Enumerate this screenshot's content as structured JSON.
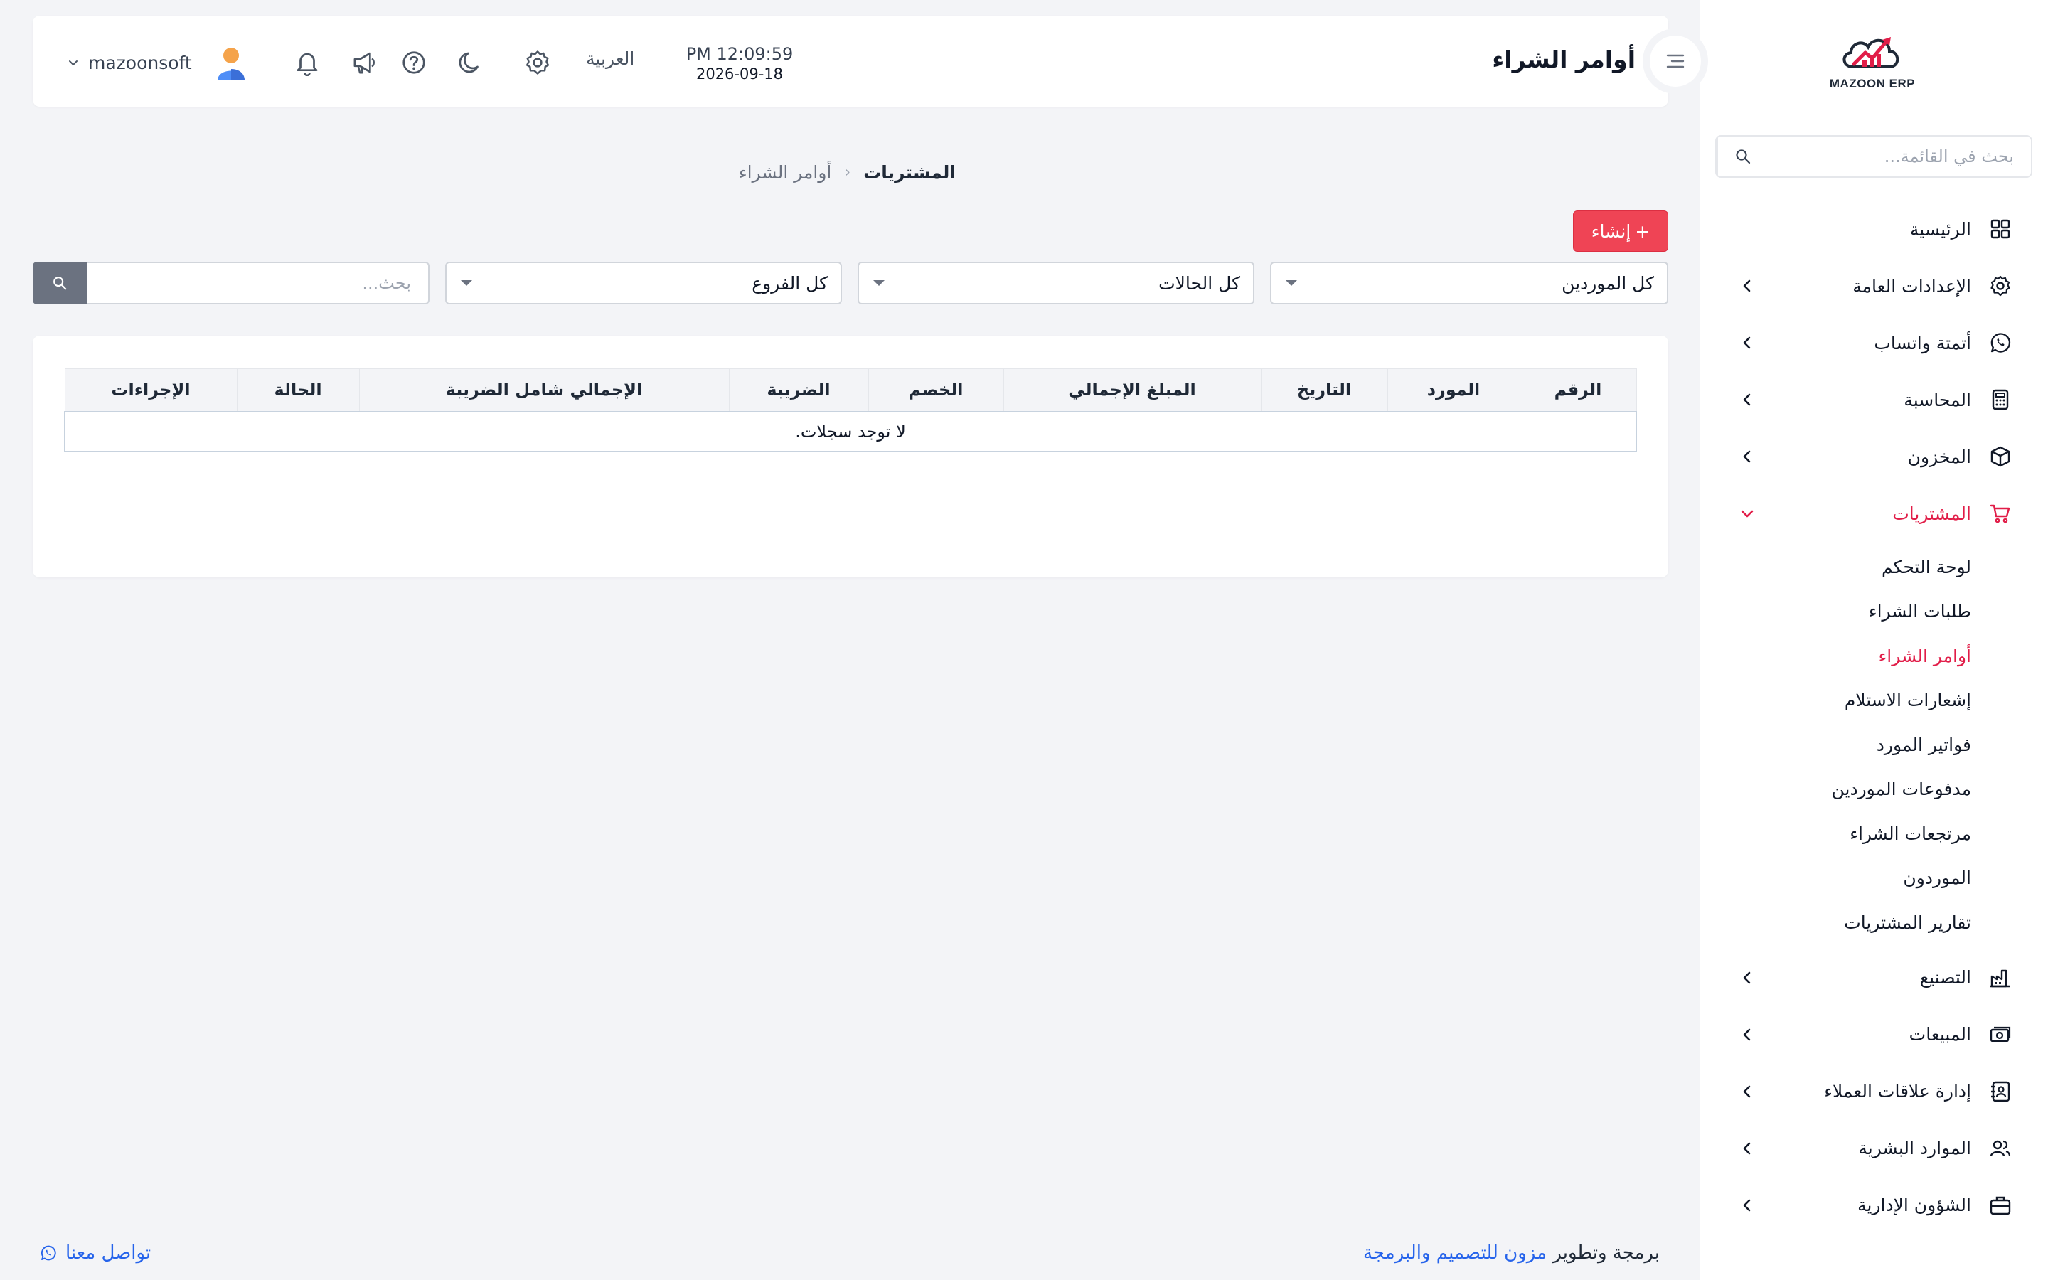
{
  "sidebar": {
    "logo_text": "MAZOON ERP",
    "search_placeholder": "بحث في القائمة...",
    "items": [
      {
        "label": "الرئيسية",
        "icon": "grid-icon"
      },
      {
        "label": "الإعدادات العامة",
        "icon": "gear-icon"
      },
      {
        "label": "أتمتة واتساب",
        "icon": "whatsapp-icon"
      },
      {
        "label": "المحاسبة",
        "icon": "calculator-icon"
      },
      {
        "label": "المخزون",
        "icon": "box-icon"
      },
      {
        "label": "المشتريات",
        "icon": "cart-icon"
      },
      {
        "label": "التصنيع",
        "icon": "factory-icon"
      },
      {
        "label": "المبيعات",
        "icon": "cash-icon"
      },
      {
        "label": "إدارة علاقات العملاء",
        "icon": "contact-book-icon"
      },
      {
        "label": "الموارد البشرية",
        "icon": "users-icon"
      },
      {
        "label": "الشؤون الإدارية",
        "icon": "briefcase-icon"
      }
    ],
    "purchases_sub": [
      "لوحة التحكم",
      "طلبات الشراء",
      "أوامر الشراء",
      "إشعارات الاستلام",
      "فواتير المورد",
      "مدفوعات الموردين",
      "مرتجعات الشراء",
      "الموردون",
      "تقارير المشتريات"
    ]
  },
  "header": {
    "title": "أوامر الشراء",
    "time": "PM 12:09:59",
    "date": "2026-09-18",
    "language": "العربية",
    "username": "mazoonsoft"
  },
  "breadcrumb": {
    "parent": "المشتريات",
    "current": "أوامر الشراء"
  },
  "actions": {
    "create_label": "إنشاء"
  },
  "filters": {
    "suppliers": "كل الموردين",
    "statuses": "كل الحالات",
    "branches": "كل الفروع",
    "search_placeholder": "بحث..."
  },
  "table": {
    "columns": [
      "الرقم",
      "المورد",
      "التاريخ",
      "المبلغ الإجمالي",
      "الخصم",
      "الضريبة",
      "الإجمالي شامل الضريبة",
      "الحالة",
      "الإجراءات"
    ],
    "empty_message": "لا توجد سجلات."
  },
  "footer": {
    "credit_prefix": "برمجة وتطوير",
    "credit_brand": "مزون للتصميم والبرمجة",
    "contact": "تواصل معنا"
  },
  "colors": {
    "accent": "#ef4455",
    "active_text": "#e11d48",
    "link": "#2563eb",
    "background": "#f3f4f7"
  }
}
